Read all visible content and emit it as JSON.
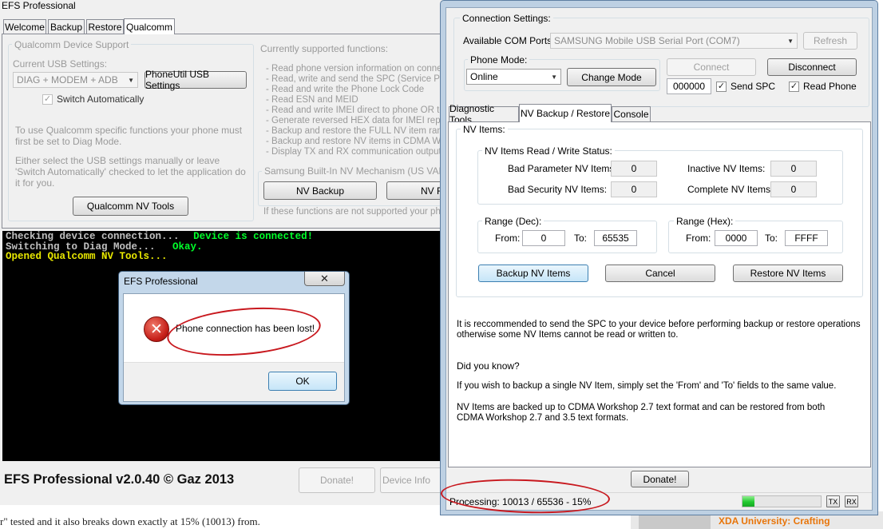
{
  "colors": {
    "console_green": "#00ff2a",
    "console_yellow": "#e8e800",
    "annotation_red": "#c8181e",
    "progress_green": "#22c930"
  },
  "left_window": {
    "title": "EFS Professional",
    "tabs": [
      "Welcome",
      "Backup",
      "Restore",
      "Qualcomm"
    ],
    "qualcomm_support": {
      "group_label": "Qualcomm Device Support",
      "current_usb_label": "Current USB Settings:",
      "usb_combo_value": "DIAG + MODEM + ADB",
      "phoneutil_button": "PhoneUtil USB Settings",
      "switch_auto_label": "Switch Automatically",
      "switch_auto_check": "✓",
      "info_1": "To use Qualcomm specific functions your phone must first be set to Diag Mode.",
      "info_2": "Either select the USB settings manually or leave 'Switch Automatically' checked to let the application do it for you.",
      "nv_tools_button": "Qualcomm NV Tools"
    },
    "supported_functions": {
      "header": "Currently supported functions:",
      "items": [
        "- Read phone version information on connection",
        "- Read, write and send the SPC (Service Progra",
        "- Read and write the Phone Lock Code",
        "- Read ESN and MEID",
        "- Read and write IMEI direct to phone OR to QR",
        "- Generate reversed HEX data for IMEI repair pu",
        "- Backup and restore the FULL NV item range.",
        "- Backup and restore NV items in CDMA Worksh",
        "- Display TX and RX communication output to th"
      ]
    },
    "samsung_nv": {
      "group_label": "Samsung Built-In NV Mechanism (US VARIAN",
      "nv_backup_button": "NV Backup",
      "nv_restore_button": "NV R",
      "note": "If these functions are not supported your phone"
    },
    "console_lines": [
      {
        "text": "Checking device connection...",
        "status": "Device is connected!"
      },
      {
        "text": "Switching to Diag Mode...",
        "status": "Okay."
      },
      {
        "text": "Opened Qualcomm NV Tools...",
        "status": ""
      }
    ],
    "footer": {
      "brand": "EFS Professional v2.0.40 © Gaz 2013",
      "donate_button": "Donate!",
      "device_info_button": "Device Info"
    }
  },
  "dialog": {
    "title": "EFS Professional",
    "close_glyph": "✕",
    "message": "Phone connection has been lost!",
    "ok_button": "OK"
  },
  "right_window": {
    "connection": {
      "group_label": "Connection Settings:",
      "com_ports_label": "Available COM Ports:",
      "com_port_value": "SAMSUNG Mobile USB Serial Port  (COM7)",
      "refresh_button": "Refresh",
      "phone_mode_label": "Phone Mode:",
      "phone_mode_value": "Online",
      "change_mode_button": "Change Mode",
      "connect_button": "Connect",
      "disconnect_button": "Disconnect",
      "spc_value": "000000",
      "send_spc_label": "Send SPC",
      "read_phone_label": "Read Phone",
      "check_glyph": "✓"
    },
    "tabs": [
      "Diagnostic Tools",
      "NV Backup / Restore",
      "Console"
    ],
    "nv_items": {
      "group_label": "NV Items:",
      "status_label": "NV Items Read / Write Status:",
      "bad_param_label": "Bad Parameter NV Items:",
      "bad_param_value": "0",
      "inactive_label": "Inactive NV Items:",
      "inactive_value": "0",
      "bad_security_label": "Bad Security NV Items:",
      "bad_security_value": "0",
      "complete_label": "Complete NV Items:",
      "complete_value": "0",
      "range_dec_label": "Range (Dec):",
      "range_hex_label": "Range (Hex):",
      "from_label": "From:",
      "to_label": "To:",
      "dec_from": "0",
      "dec_to": "65535",
      "hex_from": "0000",
      "hex_to": "FFFF",
      "backup_button": "Backup NV Items",
      "cancel_button": "Cancel",
      "restore_button": "Restore NV Items"
    },
    "info": {
      "recommend": "It is reccommended to send the SPC to your device before performing backup or restore operations otherwise some NV Items cannot be read or written to.",
      "did_you_know": "Did you know?",
      "tip_1": "If you wish to backup a single NV Item, simply set the 'From' and 'To' fields to the same value.",
      "tip_2": "NV Items are backed up to CDMA Workshop 2.7 text format and can be restored from both CDMA Workshop 2.7 and 3.5 text formats."
    },
    "donate_button": "Donate!",
    "status": {
      "processing": "Processing: 10013 / 65536 - 15%",
      "progress_fraction": 0.15,
      "tx_label": "TX",
      "rx_label": "RX"
    }
  },
  "background_page": {
    "bottom_text": "r\" tested and it also breaks down exactly at 15% (10013) from.",
    "xda_text": "XDA University: Crafting"
  }
}
